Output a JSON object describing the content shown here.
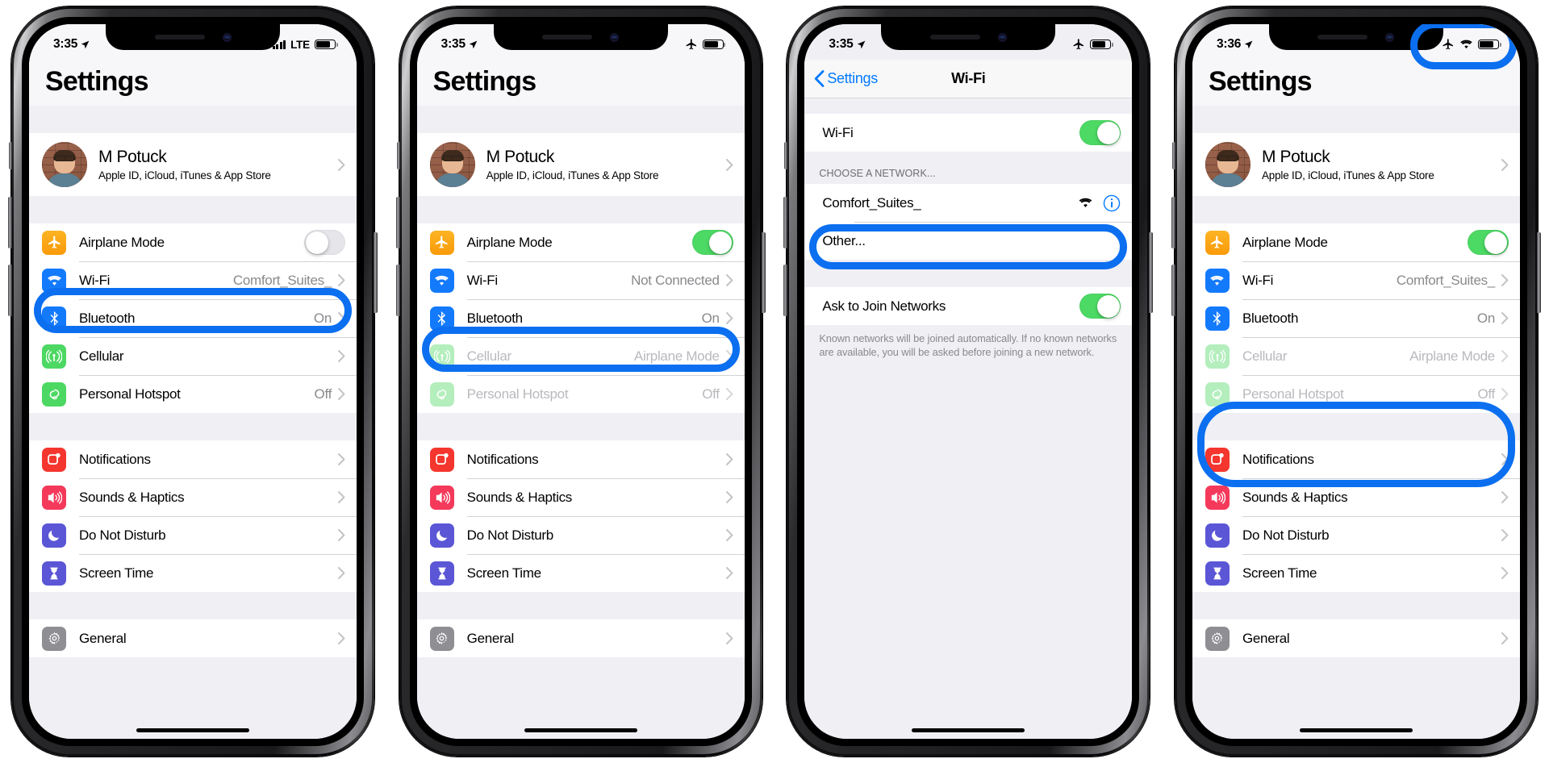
{
  "meta": {
    "accent_blue": "#0b6ff0",
    "toggle_green": "#4cd964",
    "ios_blue": "#047aff"
  },
  "phones": [
    {
      "id": "phone-1",
      "status": {
        "time": "3:35",
        "carrier_label": "LTE",
        "icons": [
          "location-arrow",
          "signal-bars",
          "lte-text",
          "battery"
        ]
      },
      "title": "Settings",
      "profile": {
        "name": "M Potuck",
        "subtitle": "Apple ID, iCloud, iTunes & App Store"
      },
      "rows_group_1": [
        {
          "label": "Airplane Mode",
          "icon": "airplane-icon",
          "control": "toggle",
          "toggle_on": false,
          "dim": false
        },
        {
          "label": "Wi-Fi",
          "icon": "wifi-icon",
          "value": "Comfort_Suites_",
          "control": "chevron",
          "dim": false
        },
        {
          "label": "Bluetooth",
          "icon": "bluetooth-icon",
          "value": "On",
          "control": "chevron",
          "dim": false
        },
        {
          "label": "Cellular",
          "icon": "cellular-icon",
          "value": "",
          "control": "chevron",
          "dim": false
        },
        {
          "label": "Personal Hotspot",
          "icon": "hotspot-icon",
          "value": "Off",
          "control": "chevron",
          "dim": false
        }
      ],
      "rows_group_2": [
        {
          "label": "Notifications",
          "icon": "notifications-icon",
          "control": "chevron"
        },
        {
          "label": "Sounds & Haptics",
          "icon": "sounds-icon",
          "control": "chevron"
        },
        {
          "label": "Do Not Disturb",
          "icon": "dnd-icon",
          "control": "chevron"
        },
        {
          "label": "Screen Time",
          "icon": "screentime-icon",
          "control": "chevron"
        }
      ],
      "rows_group_3": [
        {
          "label": "General",
          "icon": "general-gear-icon",
          "control": "chevron"
        }
      ],
      "highlight": {
        "target": "airplane-mode-row"
      }
    },
    {
      "id": "phone-2",
      "status": {
        "time": "3:35",
        "icons": [
          "location-arrow",
          "airplane",
          "battery"
        ]
      },
      "title": "Settings",
      "profile": {
        "name": "M Potuck",
        "subtitle": "Apple ID, iCloud, iTunes & App Store"
      },
      "rows_group_1": [
        {
          "label": "Airplane Mode",
          "icon": "airplane-icon",
          "control": "toggle",
          "toggle_on": true,
          "dim": false
        },
        {
          "label": "Wi-Fi",
          "icon": "wifi-icon",
          "value": "Not Connected",
          "control": "chevron",
          "dim": false
        },
        {
          "label": "Bluetooth",
          "icon": "bluetooth-icon",
          "value": "On",
          "control": "chevron",
          "dim": false
        },
        {
          "label": "Cellular",
          "icon": "cellular-icon",
          "value": "Airplane Mode",
          "control": "chevron",
          "dim": true
        },
        {
          "label": "Personal Hotspot",
          "icon": "hotspot-icon",
          "value": "Off",
          "control": "chevron",
          "dim": true
        }
      ],
      "rows_group_2": [
        {
          "label": "Notifications",
          "icon": "notifications-icon",
          "control": "chevron"
        },
        {
          "label": "Sounds & Haptics",
          "icon": "sounds-icon",
          "control": "chevron"
        },
        {
          "label": "Do Not Disturb",
          "icon": "dnd-icon",
          "control": "chevron"
        },
        {
          "label": "Screen Time",
          "icon": "screentime-icon",
          "control": "chevron"
        }
      ],
      "rows_group_3": [
        {
          "label": "General",
          "icon": "general-gear-icon",
          "control": "chevron"
        }
      ],
      "highlight": {
        "target": "wifi-row"
      }
    },
    {
      "id": "phone-3",
      "status": {
        "time": "3:35",
        "icons": [
          "location-arrow",
          "airplane",
          "battery"
        ]
      },
      "nav": {
        "back_label": "Settings",
        "title": "Wi-Fi"
      },
      "wifi_toggle_row": {
        "label": "Wi-Fi",
        "toggle_on": true
      },
      "network_section_header": "CHOOSE A NETWORK...",
      "networks": [
        {
          "label": "Comfort_Suites_",
          "has_wifi_glyph": true,
          "has_info": true
        },
        {
          "label": "Other...",
          "has_wifi_glyph": false,
          "has_info": false
        }
      ],
      "ask_row": {
        "label": "Ask to Join Networks",
        "toggle_on": true
      },
      "ask_footer": "Known networks will be joined automatically. If no known networks are available, you will be asked before joining a new network.",
      "highlight": {
        "target": "network-comfort-suites-row"
      }
    },
    {
      "id": "phone-4",
      "status": {
        "time": "3:36",
        "icons": [
          "location-arrow",
          "airplane",
          "wifi",
          "battery"
        ]
      },
      "title": "Settings",
      "profile": {
        "name": "M Potuck",
        "subtitle": "Apple ID, iCloud, iTunes & App Store"
      },
      "rows_group_1": [
        {
          "label": "Airplane Mode",
          "icon": "airplane-icon",
          "control": "toggle",
          "toggle_on": true,
          "dim": false
        },
        {
          "label": "Wi-Fi",
          "icon": "wifi-icon",
          "value": "Comfort_Suites_",
          "control": "chevron",
          "dim": false
        },
        {
          "label": "Bluetooth",
          "icon": "bluetooth-icon",
          "value": "On",
          "control": "chevron",
          "dim": false
        },
        {
          "label": "Cellular",
          "icon": "cellular-icon",
          "value": "Airplane Mode",
          "control": "chevron",
          "dim": true
        },
        {
          "label": "Personal Hotspot",
          "icon": "hotspot-icon",
          "value": "Off",
          "control": "chevron",
          "dim": true
        }
      ],
      "rows_group_2": [
        {
          "label": "Notifications",
          "icon": "notifications-icon",
          "control": "chevron"
        },
        {
          "label": "Sounds & Haptics",
          "icon": "sounds-icon",
          "control": "chevron"
        },
        {
          "label": "Do Not Disturb",
          "icon": "dnd-icon",
          "control": "chevron"
        },
        {
          "label": "Screen Time",
          "icon": "screentime-icon",
          "control": "chevron"
        }
      ],
      "rows_group_3": [
        {
          "label": "General",
          "icon": "general-gear-icon",
          "control": "chevron"
        }
      ],
      "highlight": {
        "target": "cellular-and-hotspot-rows"
      },
      "highlight2": {
        "target": "statusbar-icons"
      }
    }
  ]
}
